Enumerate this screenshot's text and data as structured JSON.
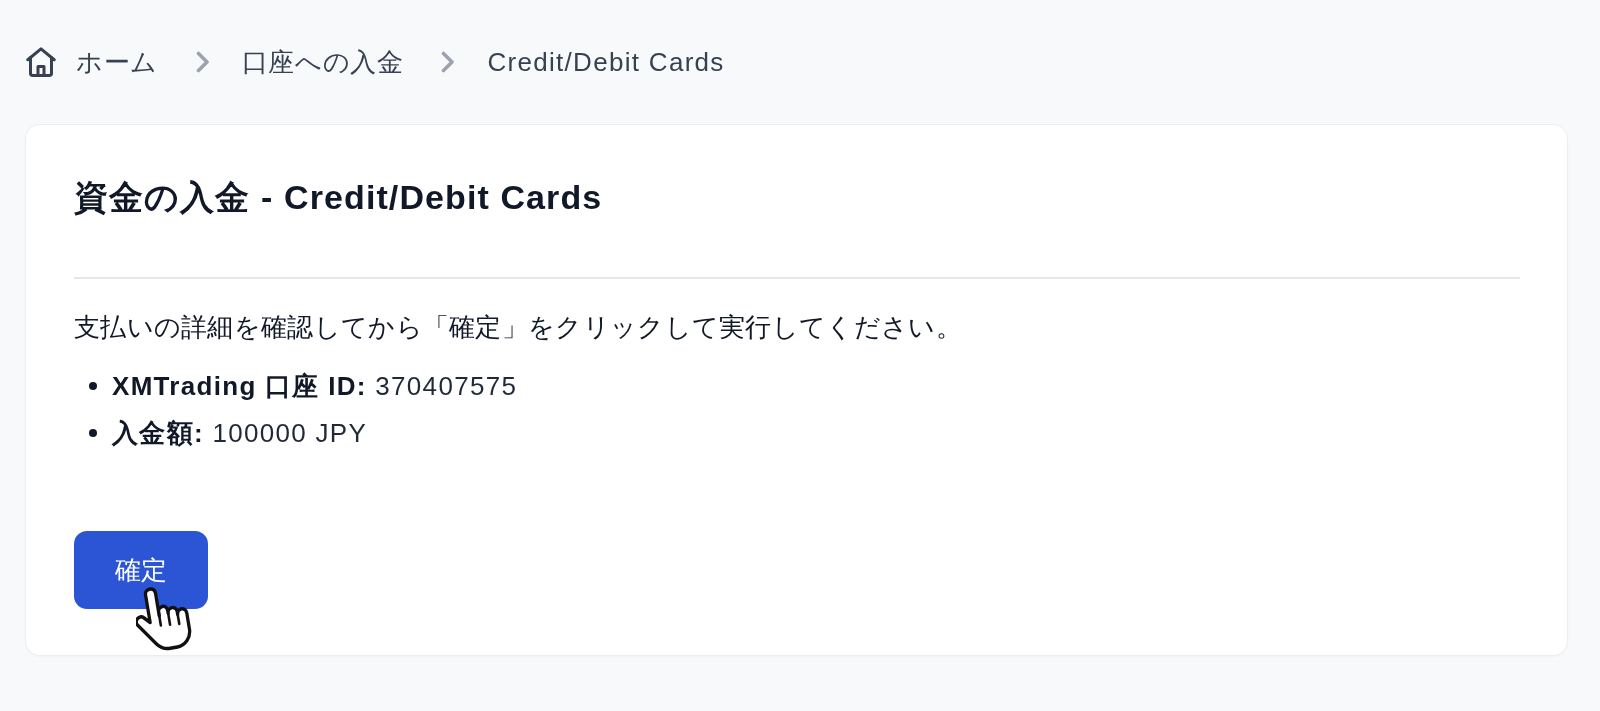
{
  "breadcrumb": [
    {
      "label": "ホーム",
      "kind": "home"
    },
    {
      "label": "口座への入金",
      "kind": "link"
    },
    {
      "label": "Credit/Debit Cards",
      "kind": "current"
    }
  ],
  "card": {
    "title": "資金の入金 - Credit/Debit Cards",
    "instruction": "支払いの詳細を確認してから「確定」をクリックして実行してください。",
    "details": [
      "**XMTrading 口座 ID:** 370407575",
      "**入金額:** 100000 JPY"
    ],
    "confirm_button": {
      "label": "確定"
    }
  }
}
